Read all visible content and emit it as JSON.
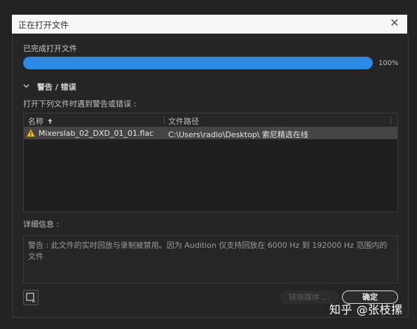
{
  "window": {
    "title": "正在打开文件",
    "close_glyph": "✕"
  },
  "status": {
    "text": "已完成打开文件",
    "progress": 1.0,
    "progress_label": "100%",
    "accent_color": "#2b8ae6"
  },
  "section": {
    "label": "警告 / 错误",
    "expanded": true,
    "icon": "chevron-down-icon"
  },
  "description": "打开下列文件时遇到警告或错误 :",
  "table": {
    "columns": [
      "名称",
      "文件路径"
    ],
    "sort_icon": "sort-up-icon",
    "rows": [
      {
        "icon": "warning-icon",
        "name": "Mixerslab_02_DXD_01_01.flac",
        "path": "C:\\Users\\radio\\Desktop\\ 索尼精选在线"
      }
    ]
  },
  "detail": {
    "label": "详细信息 :",
    "message": "警告 : 此文件的实时回放与录制被禁用。因为 Audition 仅支持回放在 6000 Hz 到 192000 Hz 范围内的文件"
  },
  "buttons": {
    "link_media": "链接媒体 ...",
    "ok": "确定",
    "bottom_icon": "export-icon"
  },
  "watermark": "知乎 @张枝摞"
}
